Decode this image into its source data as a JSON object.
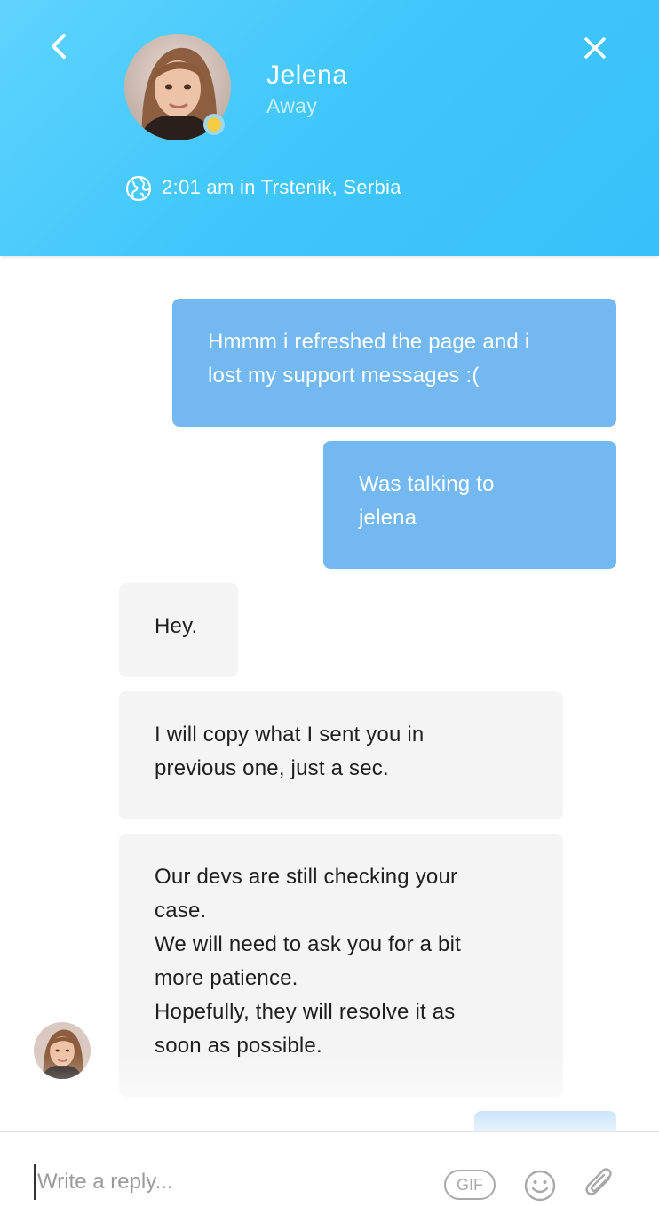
{
  "header": {
    "agent_name": "Jelena",
    "agent_status": "Away",
    "local_time": "2:01 am in Trstenik, Serbia",
    "back_icon": "chevron-left-icon",
    "close_icon": "close-icon",
    "globe_icon": "globe-icon",
    "status_color": "#f6cc45"
  },
  "messages": [
    {
      "sender": "user",
      "lines": [
        "Hmmm i refreshed the page and i",
        "lost my support messages :("
      ]
    },
    {
      "sender": "user",
      "lines": [
        "Was talking to",
        "jelena"
      ]
    },
    {
      "sender": "agent",
      "lines": [
        "Hey."
      ]
    },
    {
      "sender": "agent",
      "lines": [
        "I will copy what I sent you in",
        "previous one, just a sec."
      ]
    },
    {
      "sender": "agent",
      "lines": [
        "Our devs are still checking your",
        "case.",
        "We will need to ask you for a bit",
        "more patience.",
        "Hopefully, they will resolve it as",
        "soon as possible."
      ]
    }
  ],
  "composer": {
    "placeholder": "Write a reply...",
    "gif_label": "GIF",
    "emoji_icon": "smiley-icon",
    "attach_icon": "paperclip-icon"
  },
  "colors": {
    "header_gradient_start": "#5fd3fd",
    "header_gradient_end": "#37c0fa",
    "user_bubble": "#73b8f1",
    "agent_bubble": "#f4f4f4"
  }
}
